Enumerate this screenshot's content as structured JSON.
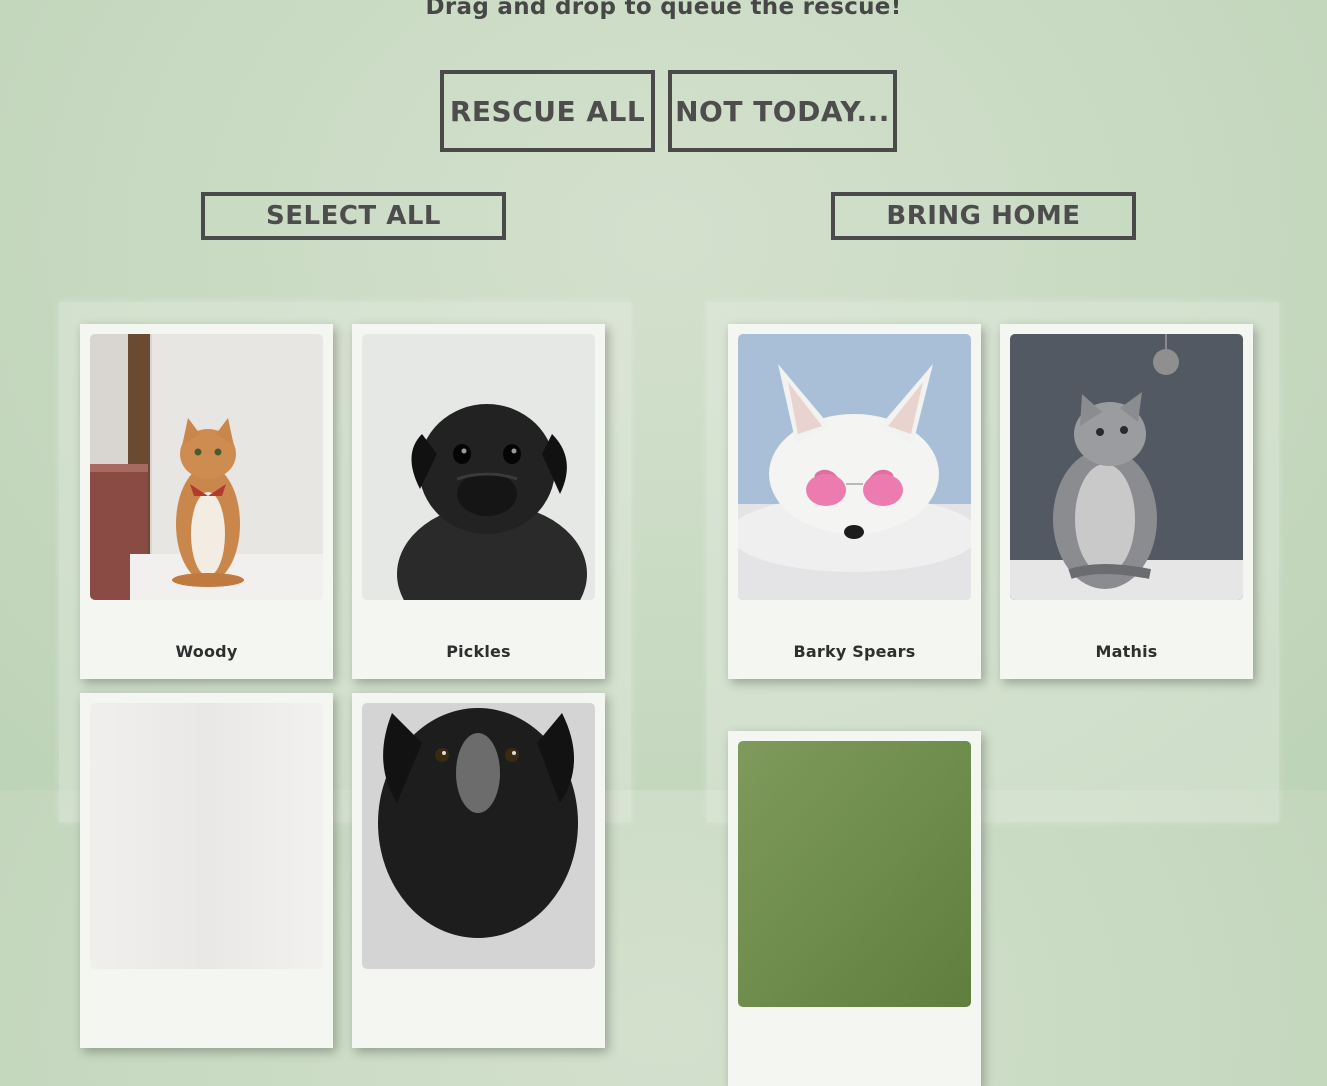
{
  "header": {
    "instruction": "Drag and drop to queue the rescue!"
  },
  "actions": {
    "rescue_all": "RESCUE ALL",
    "not_today": "NOT TODAY..."
  },
  "left_panel": {
    "select_all": "SELECT ALL",
    "pets": [
      {
        "name": "Woody",
        "photo_icon": "orange-cat-icon"
      },
      {
        "name": "Pickles",
        "photo_icon": "black-pug-icon"
      },
      {
        "name": "",
        "photo_icon": "blurred-photo-icon"
      },
      {
        "name": "",
        "photo_icon": "black-dog-icon"
      }
    ]
  },
  "right_panel": {
    "bring_home": "BRING HOME",
    "pets": [
      {
        "name": "Barky Spears",
        "photo_icon": "white-dog-pink-glasses-icon"
      },
      {
        "name": "Mathis",
        "photo_icon": "grey-fluffy-cat-icon"
      },
      {
        "name": "",
        "photo_icon": "green-photo-icon"
      }
    ]
  }
}
